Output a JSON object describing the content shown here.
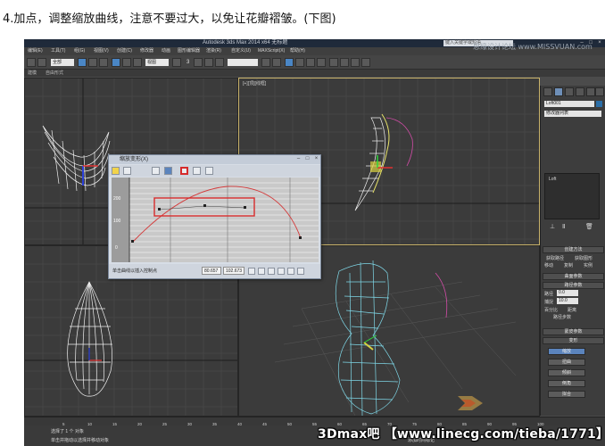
{
  "caption": "4.加点，调整缩放曲线，注意不要过大，以免让花瓣褶皱。(下图)",
  "window": {
    "title": "Autodesk 3ds Max 2014 x64    无标题",
    "search_placeholder": "键入关键字或短语"
  },
  "menubar": {
    "items": [
      "编辑(E)",
      "工具(T)",
      "组(G)",
      "视图(V)",
      "创建(C)",
      "修改器",
      "动画",
      "图形编辑器",
      "渲染(R)",
      "自定义(U)",
      "MAXScript(X)",
      "帮助(H)"
    ]
  },
  "toolbar": {
    "selection_filter": "全部",
    "view_dropdown": "视图",
    "snap_count": "3"
  },
  "ribbon": {
    "items": [
      "建模",
      "自由形式",
      "选择",
      "对象绘制",
      "填充"
    ]
  },
  "viewports": {
    "top_right_label": "[+][顶][线框]"
  },
  "command_panel": {
    "object_name": "Loft001",
    "modifier_list": "修改器列表",
    "stack_item": "Loft",
    "rollouts": [
      "创建方法",
      "曲面参数",
      "路径参数",
      "蒙皮参数",
      "变形"
    ],
    "creation": {
      "get_path": "获取路径",
      "get_shape": "获取图形",
      "move": "移动",
      "copy": "复制",
      "instance": "实例"
    },
    "path_params": {
      "path_label": "路径",
      "path_value": "0.0",
      "snap_label": "捕捉",
      "snap_value": "10.0",
      "percent": "百分比",
      "distance": "距离",
      "path_steps": "路径步数"
    },
    "deform_buttons": [
      "缩放",
      "扭曲",
      "倾斜",
      "倒角",
      "拟合"
    ]
  },
  "deform_dialog": {
    "title": "缩放变形(X)",
    "y_ticks": [
      "200",
      "100",
      "0"
    ],
    "status_hint": "单击曲线以插入控制点",
    "field1": "80.657",
    "field2": "102.673"
  },
  "statusbar": {
    "selection": "选择了 1 个 对象",
    "hint": "单击并拖动以选择并移动对象",
    "add_time_tag": "添加时间标记"
  },
  "timeline": {
    "ticks": [
      "5",
      "10",
      "15",
      "20",
      "25",
      "30",
      "35",
      "40",
      "45",
      "50",
      "55",
      "60",
      "65",
      "70",
      "75",
      "80",
      "85",
      "90",
      "95",
      "100"
    ]
  },
  "watermark": {
    "text": "3Dmax吧 【www.linecg.com/tieba/1771】",
    "top_text": "思缘设计论坛 www.MISSVUAN.com"
  }
}
